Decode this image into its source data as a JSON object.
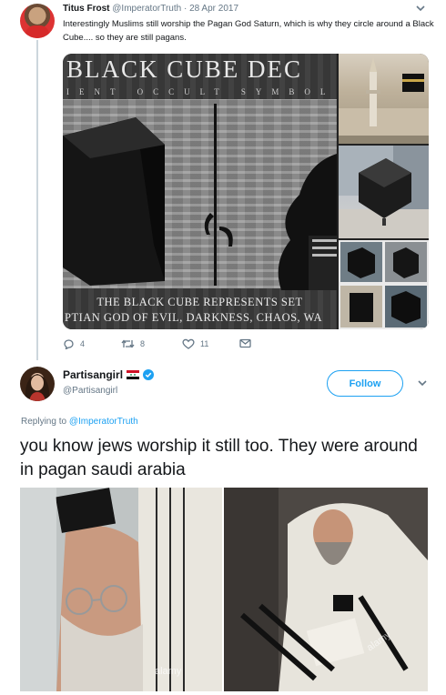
{
  "parent_tweet": {
    "name": "Titus Frost",
    "handle": "@ImperatorTruth",
    "date": "· 28 Apr 2017",
    "text": "Interestingly Muslims still worship the Pagan God Saturn, which is why they circle around a Black Cube.... so they are still pagans.",
    "media": {
      "title": "BLACK CUBE DEC",
      "subtitle": "IENT  OCCULT  SYMBOL",
      "caption_line1": "THE BLACK CUBE REPRESENTS SET",
      "caption_line2": "PTIAN GOD OF EVIL, DARKNESS, CHAOS, WA"
    },
    "stats": {
      "replies": "4",
      "retweets": "8",
      "likes": "11"
    },
    "icons": {
      "reply": "reply-icon",
      "retweet": "retweet-icon",
      "like": "heart-icon",
      "dm": "envelope-icon",
      "menu": "chevron-down-icon"
    }
  },
  "reply_tweet": {
    "name": "Partisangirl",
    "handle": "@Partisangirl",
    "follow_label": "Follow",
    "replying_prefix": "Replying to",
    "replying_to": "@ImperatorTruth",
    "text": "you know jews worship it still too. They were around in pagan saudi arabia",
    "watermark": "alamy",
    "icons": {
      "flag": "syria-flag-icon",
      "verified": "verified-badge-icon",
      "menu": "chevron-down-icon"
    }
  },
  "colors": {
    "accent": "#1da1f2",
    "text_primary": "#14171a",
    "text_secondary": "#657786",
    "thread_line": "#ccd6dd"
  }
}
